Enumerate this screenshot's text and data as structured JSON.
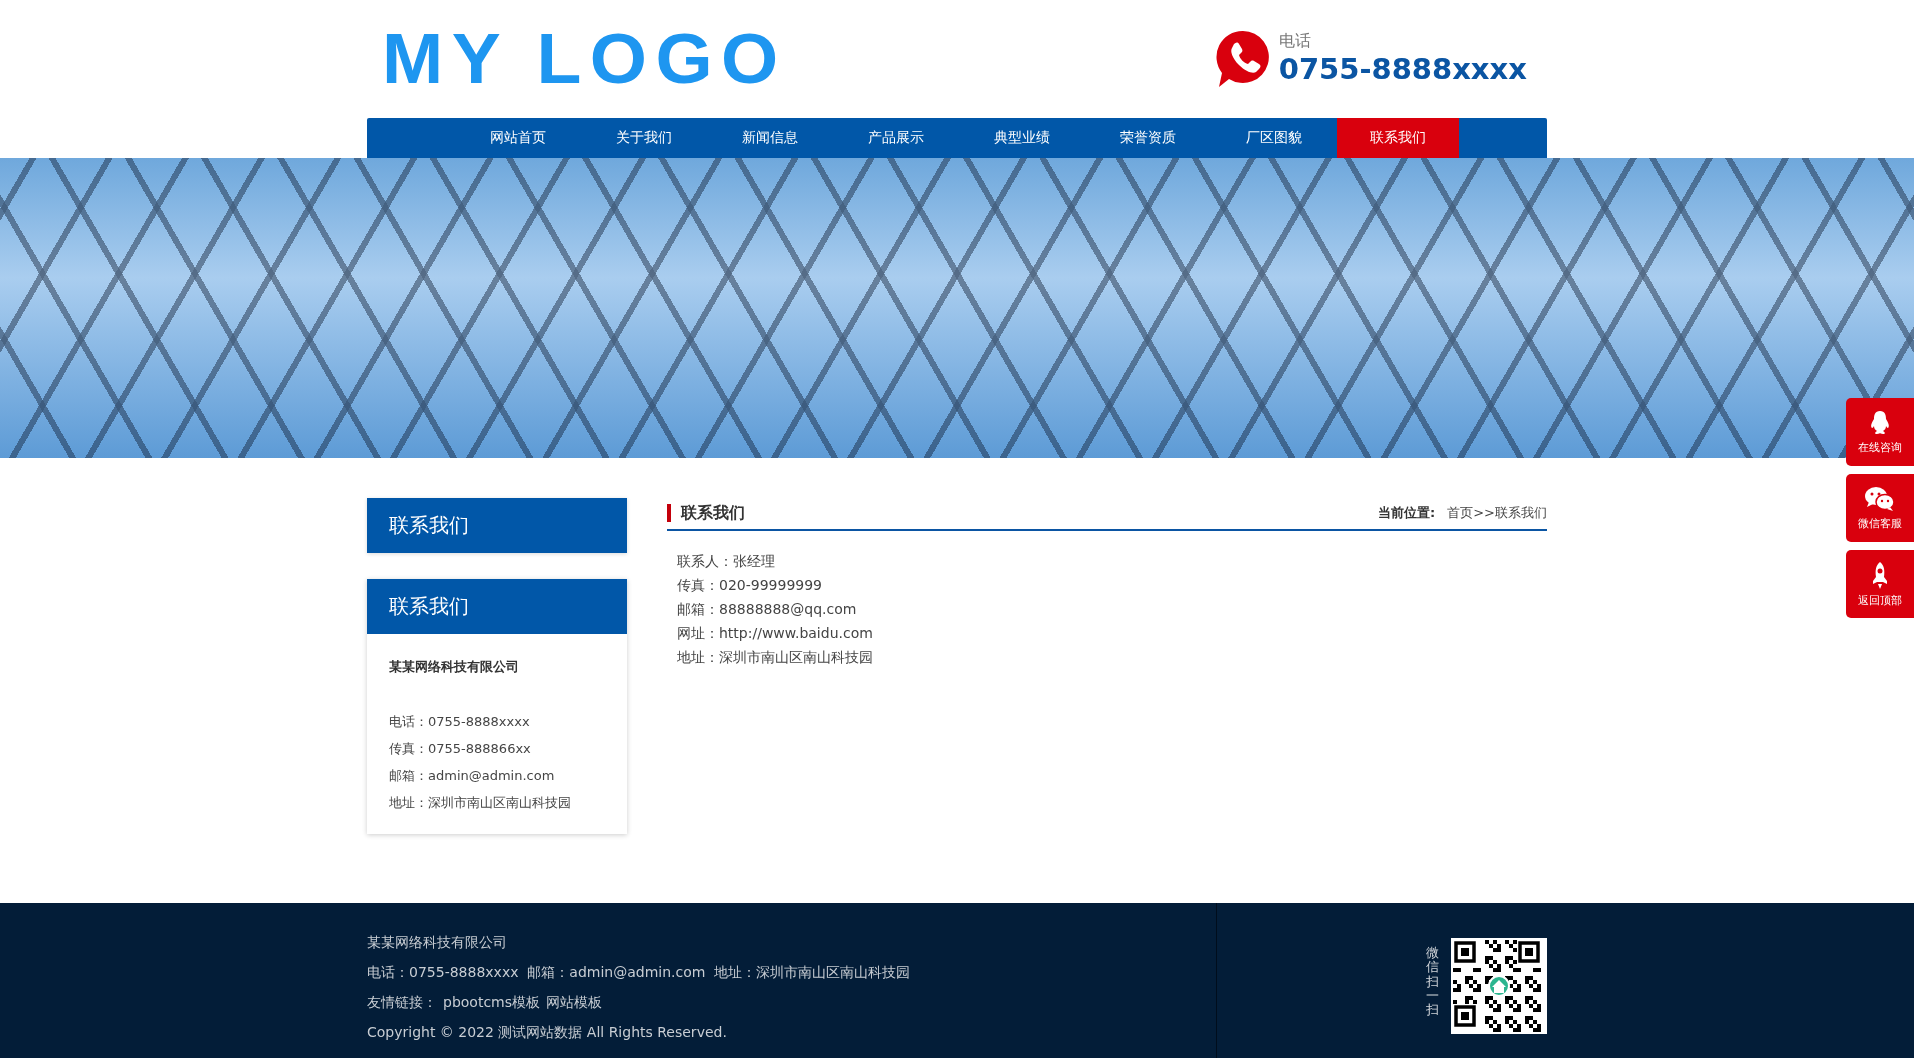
{
  "header": {
    "logo": "MY LOGO",
    "phone": {
      "label": "电话",
      "number": "0755-8888xxxx"
    }
  },
  "nav": [
    {
      "label": "网站首页",
      "selected": false
    },
    {
      "label": "关于我们",
      "selected": false
    },
    {
      "label": "新闻信息",
      "selected": false
    },
    {
      "label": "产品展示",
      "selected": false
    },
    {
      "label": "典型业绩",
      "selected": false
    },
    {
      "label": "荣誉资质",
      "selected": false
    },
    {
      "label": "厂区图貌",
      "selected": false
    },
    {
      "label": "联系我们",
      "selected": true
    }
  ],
  "sidebar": {
    "nav_title": "联系我们",
    "contact_card": {
      "title": "联系我们",
      "company": "某某网络科技有限公司",
      "lines": [
        "电话：0755-8888xxxx",
        "传真：0755-888866xx",
        "邮箱：admin@admin.com",
        "地址：深圳市南山区南山科技园"
      ]
    }
  },
  "main": {
    "title": "联系我们",
    "breadcrumb": {
      "label": "当前位置:",
      "path": "首页>>联系我们"
    },
    "lines": [
      "联系人：张经理",
      "传真：020-99999999",
      "邮箱：88888888@qq.com",
      "网址：http://www.baidu.com",
      "地址：深圳市南山区南山科技园"
    ]
  },
  "float_buttons": [
    {
      "kind": "qq",
      "label": "在线咨询"
    },
    {
      "kind": "wechat",
      "label": "微信客服"
    },
    {
      "kind": "top",
      "label": "返回顶部"
    }
  ],
  "footer": {
    "company": "某某网络科技有限公司",
    "contact_line": "电话：0755-8888xxxx  邮箱：admin@admin.com  地址：深圳市南山区南山科技园",
    "links_label": "友情链接：",
    "links": [
      "pbootcms模板",
      "网站模板"
    ],
    "copyright": "Copyright © 2022 测试网站数据 All Rights Reserved.",
    "qr_caption": "微信扫一扫"
  }
}
